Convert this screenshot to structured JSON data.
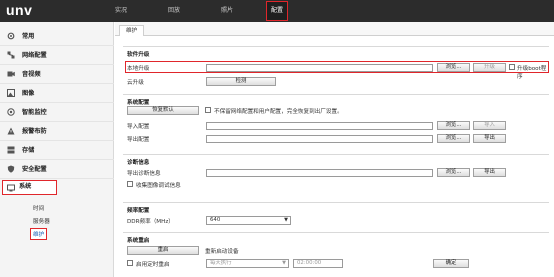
{
  "brand": "unv",
  "nav": [
    "实况",
    "回放",
    "照片",
    "配置"
  ],
  "sidebar": {
    "items": [
      "常用",
      "网络配置",
      "音视频",
      "图像",
      "智能监控",
      "报警布防",
      "存储",
      "安全配置",
      "系统"
    ],
    "sub_items": [
      "时间",
      "服务器",
      "维护"
    ]
  },
  "tab": "维护",
  "upgrade": {
    "title": "软件升级",
    "local_label": "本地升级",
    "browse": "浏览...",
    "upgrade_btn": "升级",
    "boot_label": "升级boot程序",
    "cloud_label": "云升级",
    "detect_btn": "检测"
  },
  "sysconfig": {
    "title": "系统配置",
    "restore_btn": "恢复默认",
    "keep_label": "不保留网络配置和用户配置，完全恢复到出厂设置。",
    "import_label": "导入配置",
    "export_label": "导出配置",
    "browse": "浏览...",
    "import_btn": "导入",
    "export_btn": "导出"
  },
  "diag": {
    "title": "诊断信息",
    "export_label": "导出诊断信息",
    "browse": "浏览...",
    "export_btn": "导出",
    "collect_label": "收集图像调试信息"
  },
  "freq": {
    "title": "频率配置",
    "ddr_label": "DDR频率（MHz）",
    "ddr_value": "640"
  },
  "reboot": {
    "title": "系统重启",
    "reboot_btn": "重启",
    "reboot_hint": "重新启动设备",
    "timed_label": "启用定时重启",
    "schedule_value": "每天执行",
    "time_value": "02:00:00",
    "confirm_btn": "确定"
  },
  "colors": {
    "topbar": "#2c2c2c",
    "highlight": "#e0262b",
    "link": "#1a5fb4"
  }
}
